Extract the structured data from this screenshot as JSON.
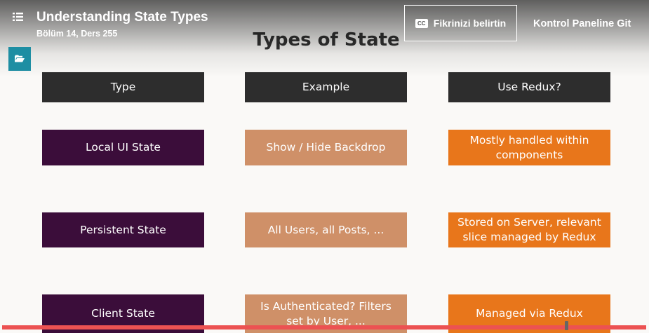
{
  "header": {
    "lecture_title": "Understanding State Types",
    "lecture_subtitle": "Bölüm 14, Ders 255",
    "feedback_label": "Fikrinizi belirtin",
    "cc_label": "CC",
    "dashboard_label": "Kontrol Paneline Git"
  },
  "slide": {
    "title": "Types of State",
    "headers": [
      "Type",
      "Example",
      "Use Redux?"
    ],
    "rows": [
      {
        "type": "Local UI State",
        "example": "Show / Hide Backdrop",
        "redux": "Mostly handled within components"
      },
      {
        "type": "Persistent State",
        "example": "All Users, all Posts, ...",
        "redux": "Stored on Server, relevant slice managed by Redux"
      },
      {
        "type": "Client State",
        "example": "Is Authenticated? Filters set by User, ...",
        "redux": "Managed via Redux"
      }
    ]
  },
  "colors": {
    "header_cell": "#2d2d2d",
    "type_cell": "#3b0d3a",
    "example_cell": "#cf9068",
    "redux_cell": "#e8761b",
    "progress": "#ec5252",
    "folder_button": "#1e8ea3"
  },
  "icons": {
    "menu": "list-icon",
    "feedback": "closed-caption-icon",
    "folder": "folder-open-icon"
  }
}
